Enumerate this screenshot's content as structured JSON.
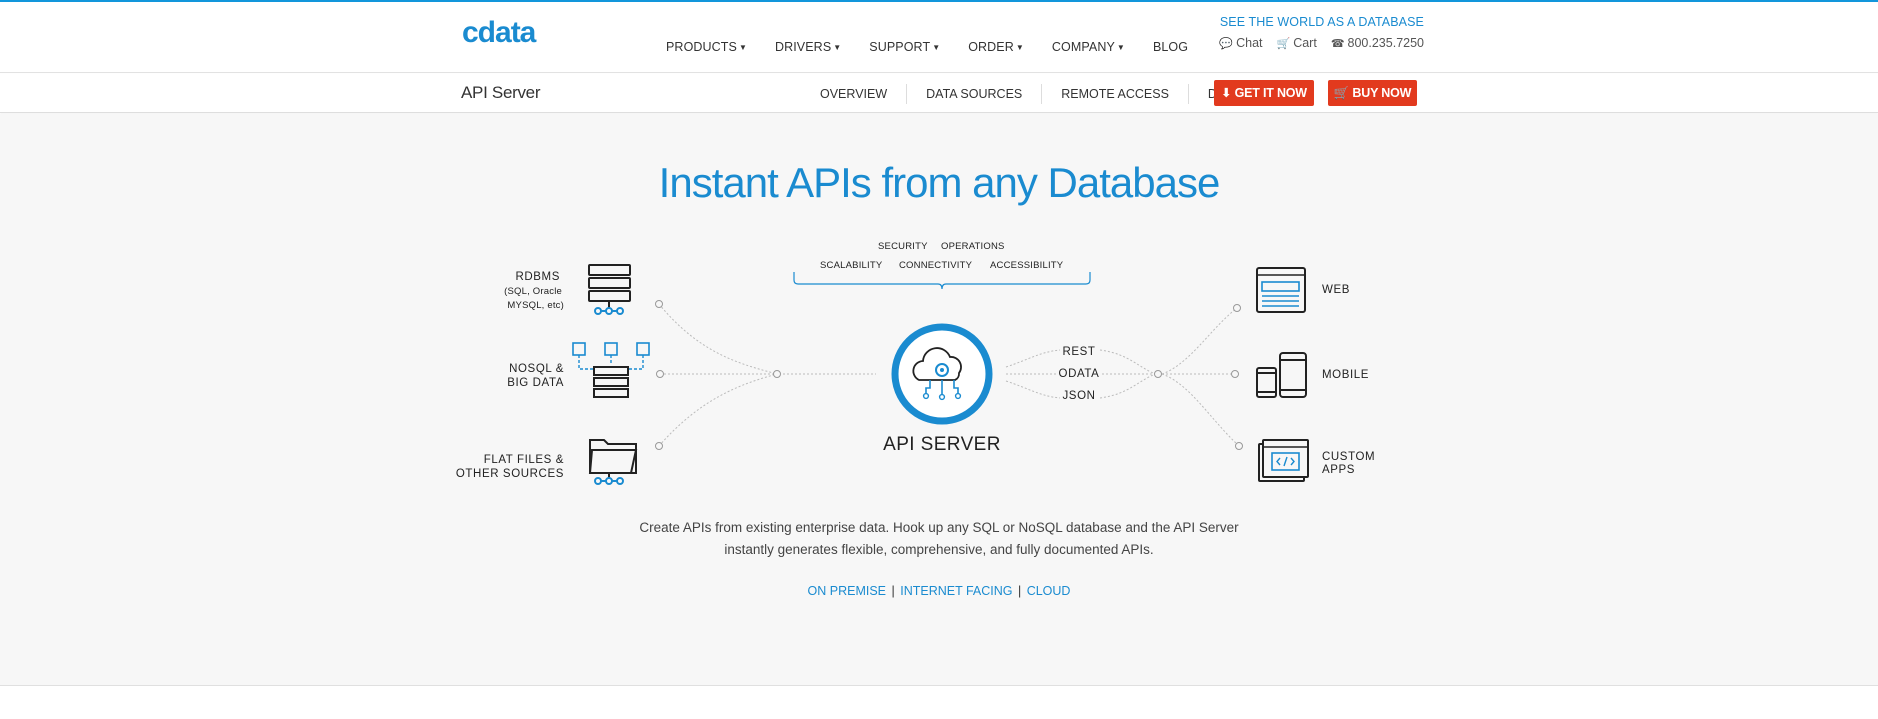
{
  "header": {
    "logo_text": "cdata",
    "tagline": "SEE THE WORLD AS A DATABASE",
    "nav": [
      {
        "label": "PRODUCTS"
      },
      {
        "label": "DRIVERS"
      },
      {
        "label": "SUPPORT"
      },
      {
        "label": "ORDER"
      },
      {
        "label": "COMPANY"
      },
      {
        "label": "BLOG"
      }
    ],
    "utility": {
      "chat": "Chat",
      "cart": "Cart",
      "phone": "800.235.7250"
    }
  },
  "subnav": {
    "product": "API Server",
    "links": [
      "OVERVIEW",
      "DATA SOURCES",
      "REMOTE ACCESS",
      "DOCS"
    ],
    "get_button": "GET IT NOW",
    "buy_button": "BUY NOW"
  },
  "hero": {
    "title": "Instant APIs from any Database",
    "features_row1": [
      "SECURITY",
      "OPERATIONS"
    ],
    "features_row2": [
      "SCALABILITY",
      "CONNECTIVITY",
      "ACCESSIBILITY"
    ],
    "sources": [
      {
        "title": "RDBMS",
        "sub1": "(SQL, Oracle",
        "sub2": "MYSQL, etc)"
      },
      {
        "title": "NOSQL &",
        "title2": "BIG DATA"
      },
      {
        "title": "FLAT FILES &",
        "title2": "OTHER SOURCES"
      }
    ],
    "center_label": "API SERVER",
    "protocols": [
      "REST",
      "ODATA",
      "JSON"
    ],
    "targets": [
      {
        "title": "WEB"
      },
      {
        "title": "MOBILE"
      },
      {
        "title": "CUSTOM",
        "title2": "APPS"
      }
    ],
    "description_line1": "Create APIs from existing enterprise data. Hook up any SQL or NoSQL database and the API Server",
    "description_line2": "instantly generates flexible, comprehensive, and fully documented APIs.",
    "deploy_links": [
      "ON PREMISE",
      "INTERNET FACING",
      "CLOUD"
    ]
  },
  "colors": {
    "brand_blue": "#1a8bd0",
    "cta_red": "#e23a1e",
    "hero_bg": "#f7f7f7"
  }
}
